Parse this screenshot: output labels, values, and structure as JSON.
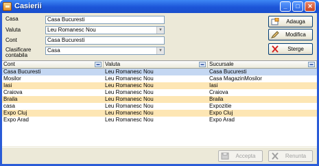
{
  "window": {
    "title": "Casierii"
  },
  "form": {
    "casa_label": "Casa",
    "casa_value": "Casa Bucuresti",
    "valuta_label": "Valuta",
    "valuta_value": "Leu Romanesc Nou",
    "cont_label": "Cont",
    "cont_value": "Casa Bucuresti",
    "clasificare_label_1": "Clasificare",
    "clasificare_label_2": "contabila",
    "clasificare_value": "Casa"
  },
  "actions": {
    "adauga": "Adauga",
    "modifica": "Modifica",
    "sterge": "Sterge"
  },
  "grid": {
    "columns": [
      "Cont",
      "Valuta",
      "Sucursale"
    ],
    "rows": [
      [
        "Casa Bucuresti",
        "Leu Romanesc Nou",
        "Casa Bucuresti"
      ],
      [
        "Mosilor",
        "Leu Romanesc Nou",
        "Casa MagazinMosilor"
      ],
      [
        "Iasi",
        "Leu Romanesc Nou",
        "Iasi"
      ],
      [
        "Craiova",
        "Leu Romanesc Nou",
        "Craiova"
      ],
      [
        "Braila",
        "Leu Romanesc Nou",
        "Braila"
      ],
      [
        "casa",
        "Leu Romanesc Nou",
        "Expozitie"
      ],
      [
        "Expo Cluj",
        "Leu Romanesc Nou",
        "Expo Cluj"
      ],
      [
        "Expo Arad",
        "Leu Romanesc Nou",
        "Expo Arad"
      ]
    ]
  },
  "footer": {
    "accepta": "Accepta",
    "renunta": "Renunta"
  },
  "colors": {
    "title_bar": "#1c55d8",
    "selected_row": "#c4d7f2",
    "alternate_row": "#fde6b4"
  }
}
